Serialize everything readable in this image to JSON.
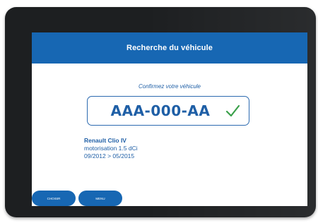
{
  "header": {
    "title": "Recherche du véhicule"
  },
  "prompt": {
    "text": "Confirmez votre véhicule"
  },
  "plate": {
    "number": "AAA-000-AA",
    "status_icon": "check-icon",
    "status_color": "#3aa04a"
  },
  "vehicle": {
    "name": "Renault Clio IV",
    "engine": "motorisation 1.5 dCi",
    "years": "09/2012 > 05/2015"
  },
  "buttons": {
    "left_label": "CHOISIR",
    "right_label": "MENU"
  },
  "colors": {
    "brand_blue": "#1767b3",
    "text_blue": "#1f5fa6"
  }
}
